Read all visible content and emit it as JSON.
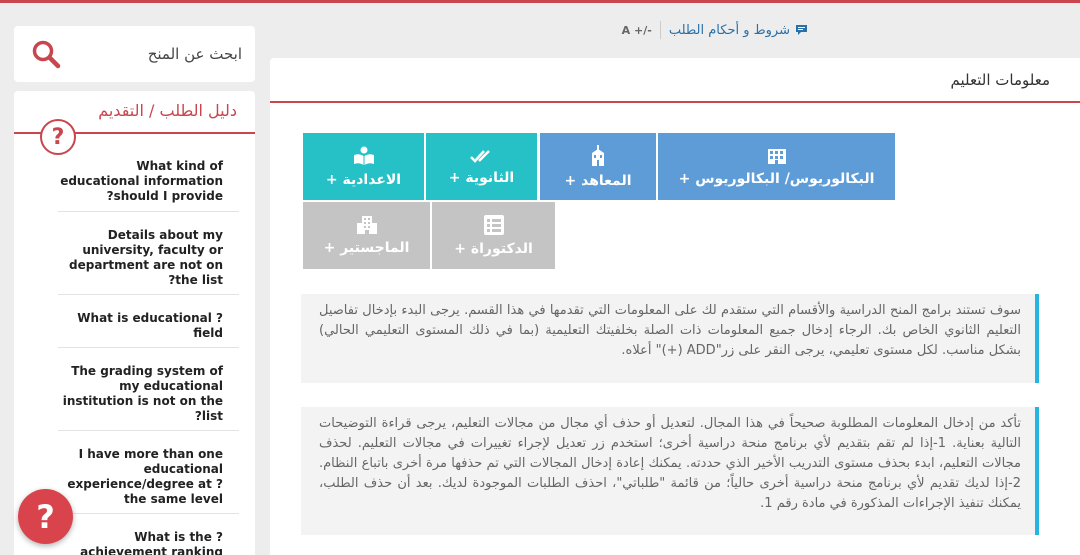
{
  "toolbar": {
    "terms_label": "شروط و أحكام الطلب",
    "font_size_label": "A +/-"
  },
  "card": {
    "title": "معلومات التعليم"
  },
  "levels": [
    {
      "label": "البكالوريوس/ البكالوريوس +",
      "icon": "building-icon",
      "color": "#5d9cd6"
    },
    {
      "label": "المعاهد +",
      "icon": "institute-icon",
      "color": "#5d9cd6"
    },
    {
      "label": "الثانوية +",
      "icon": "double-check-icon",
      "color": "#26c0c7"
    },
    {
      "label": "الاعدادية +",
      "icon": "book-icon",
      "color": "#26c0c7"
    },
    {
      "label": "الدكتوراة +",
      "icon": "list-icon",
      "color": "#c4c4c4"
    },
    {
      "label": "الماجستير +",
      "icon": "buildings-icon",
      "color": "#c4c4c4"
    }
  ],
  "info": {
    "box1": "سوف تستند برامج المنح الدراسية والأقسام التي ستقدم لك على المعلومات التي تقدمها في هذا القسم. يرجى البدء بإدخال تفاصيل التعليم الثانوي الخاص بك. الرجاء إدخال جميع المعلومات ذات الصلة بخلفيتك التعليمية (بما في ذلك المستوى التعليمي الحالي) بشكل مناسب. لكل مستوى تعليمي، يرجى النقر على زر\"ADD (+)\" أعلاه.",
    "box2": "تأكد من إدخال المعلومات المطلوبة صحيحاً في هذا المجال. لتعديل أو حذف أي مجال من مجالات التعليم، يرجى قراءة التوضيحات التالية بعناية. 1-إذا لم تقم بتقديم لأي برنامج منحة دراسية أخرى؛ استخدم زر تعديل لإجراء تغييرات في مجالات التعليم. لحذف مجالات التعليم، ابدء بحذف مستوى التدريب الأخير الذي حددته. يمكنك إعادة إدخال المجالات التي تم حذفها مرة أخرى باتباع النظام. 2-إذا لديك تقديم لأي برنامج منحة دراسية أخرى حالياً؛ من قائمة \"طلباتي\"، احذف الطلبات الموجودة لديك. بعد أن حذف الطلب، يمكنك تنفيذ الإجراءات المذكورة في مادة رقم 1."
  },
  "sidebar": {
    "search_placeholder": "ابحث عن المنح",
    "guide_title": "دليل الطلب / التقديم",
    "faq": [
      "What kind of educational information ?should I provide",
      "Details about my university, faculty or department are not on ?the list",
      "What is educational ?field",
      "The grading system of my educational institution is not on the ?list",
      "I have more than one educational experience/degree at ?the same level",
      "What is the ?achievement ranking"
    ]
  },
  "help_fab": "?",
  "colors": {
    "accent_red": "#c9464f",
    "teal": "#26c0c7",
    "blue": "#5d9cd6",
    "gray": "#c4c4c4",
    "info_border": "#28b4e0"
  }
}
